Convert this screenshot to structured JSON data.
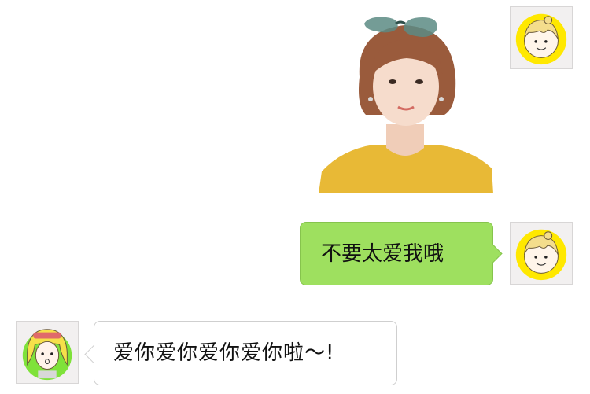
{
  "messages": [
    {
      "type": "image",
      "direction": "sent",
      "image_subject": "sticker-photo-woman-sunglasses"
    },
    {
      "type": "text",
      "direction": "sent",
      "text": "不要太爱我哦"
    },
    {
      "type": "text",
      "direction": "received",
      "text": "爱你爱你爱你爱你啦～!"
    }
  ],
  "avatars": {
    "self": "avatar-cartoon-girl-yellow",
    "other": "avatar-cartoon-girl-green"
  },
  "colors": {
    "sent_bubble": "#9ee05f",
    "received_bubble": "#ffffff",
    "background": "#ffffff"
  }
}
